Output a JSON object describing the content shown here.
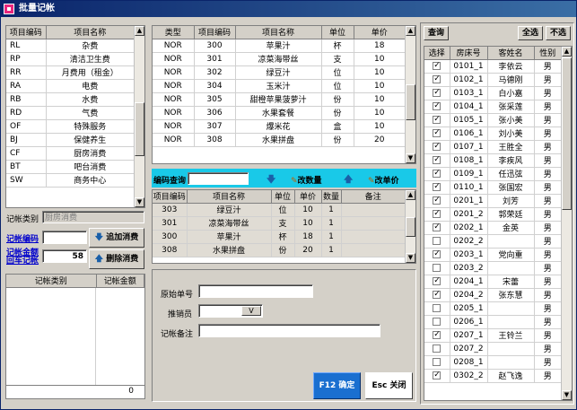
{
  "window": {
    "title": "批量记帐"
  },
  "items_table": {
    "headers": [
      "项目编码",
      "项目名称"
    ],
    "rows": [
      [
        "RL",
        "杂费"
      ],
      [
        "RP",
        "清洁卫生费"
      ],
      [
        "RR",
        "月费用（租金）"
      ],
      [
        "RA",
        "电费"
      ],
      [
        "RB",
        "水费"
      ],
      [
        "RD",
        "气费"
      ],
      [
        "OF",
        "特殊服务"
      ],
      [
        "BJ",
        "保健养生"
      ],
      [
        "CF",
        "厨房消费"
      ],
      [
        "BT",
        "吧台消费"
      ],
      [
        "SW",
        "商务中心"
      ]
    ]
  },
  "account_type": {
    "label": "记帐类别",
    "value": "厨房消费"
  },
  "account_code": {
    "label": "记帐编码",
    "value": ""
  },
  "account_amount": {
    "label": "记帐金额",
    "value": "58"
  },
  "post_label": "回车记帐",
  "add_button": "追加消费",
  "delete_button": "删除消费",
  "summary_table": {
    "headers": [
      "记帐类别",
      "记帐金额"
    ],
    "total": "0"
  },
  "product_table": {
    "headers": [
      "类型",
      "项目编码",
      "项目名称",
      "单位",
      "单价"
    ],
    "rows": [
      [
        "NOR",
        "300",
        "苹果汁",
        "杯",
        "18"
      ],
      [
        "NOR",
        "301",
        "凉菜海带丝",
        "支",
        "10"
      ],
      [
        "NOR",
        "302",
        "绿豆汁",
        "位",
        "10"
      ],
      [
        "NOR",
        "304",
        "玉米汁",
        "位",
        "10"
      ],
      [
        "NOR",
        "305",
        "甜橙苹果菠萝汁",
        "份",
        "10"
      ],
      [
        "NOR",
        "306",
        "水果套餐",
        "份",
        "10"
      ],
      [
        "NOR",
        "307",
        "爆米花",
        "盒",
        "10"
      ],
      [
        "NOR",
        "308",
        "水果拼盘",
        "份",
        "20"
      ]
    ]
  },
  "code_query": {
    "label": "编码查询",
    "value": ""
  },
  "change_qty": "改数量",
  "change_price": "改单价",
  "selected_table": {
    "headers": [
      "项目编码",
      "项目名称",
      "单位",
      "单价",
      "数量",
      "备注"
    ],
    "rows": [
      [
        "303",
        "绿豆汁",
        "位",
        "10",
        "1",
        ""
      ],
      [
        "301",
        "凉菜海带丝",
        "支",
        "10",
        "1",
        ""
      ],
      [
        "300",
        "苹果汁",
        "杯",
        "18",
        "1",
        ""
      ],
      [
        "308",
        "水果拼盘",
        "份",
        "20",
        "1",
        ""
      ]
    ]
  },
  "form": {
    "orig_no_label": "原始单号",
    "orig_no_value": "",
    "seller_label": "推销员",
    "seller_value": "",
    "note_label": "记帐备注",
    "note_value": ""
  },
  "confirm_button": "F12 确定",
  "close_button": "Esc 关闭",
  "query_button": "查询",
  "select_all_button": "全选",
  "select_none_button": "不选",
  "rooms_table": {
    "headers": [
      "选择",
      "房床号",
      "客姓名",
      "性别"
    ],
    "rows": [
      {
        "checked": true,
        "room": "0101_1",
        "name": "李依云",
        "sex": "男"
      },
      {
        "checked": true,
        "room": "0102_1",
        "name": "马德刚",
        "sex": "男"
      },
      {
        "checked": true,
        "room": "0103_1",
        "name": "白小嘉",
        "sex": "男"
      },
      {
        "checked": true,
        "room": "0104_1",
        "name": "张采莲",
        "sex": "男"
      },
      {
        "checked": true,
        "room": "0105_1",
        "name": "张小美",
        "sex": "男"
      },
      {
        "checked": true,
        "room": "0106_1",
        "name": "刘小美",
        "sex": "男"
      },
      {
        "checked": true,
        "room": "0107_1",
        "name": "王胜全",
        "sex": "男"
      },
      {
        "checked": true,
        "room": "0108_1",
        "name": "李疾风",
        "sex": "男"
      },
      {
        "checked": true,
        "room": "0109_1",
        "name": "任迅弦",
        "sex": "男"
      },
      {
        "checked": true,
        "room": "0110_1",
        "name": "张国宏",
        "sex": "男"
      },
      {
        "checked": true,
        "room": "0201_1",
        "name": "刘芳",
        "sex": "男"
      },
      {
        "checked": true,
        "room": "0201_2",
        "name": "郭荣廷",
        "sex": "男"
      },
      {
        "checked": true,
        "room": "0202_1",
        "name": "金英",
        "sex": "男"
      },
      {
        "checked": false,
        "room": "0202_2",
        "name": "",
        "sex": "男"
      },
      {
        "checked": true,
        "room": "0203_1",
        "name": "党向重",
        "sex": "男"
      },
      {
        "checked": false,
        "room": "0203_2",
        "name": "",
        "sex": "男"
      },
      {
        "checked": true,
        "room": "0204_1",
        "name": "宋蕾",
        "sex": "男"
      },
      {
        "checked": true,
        "room": "0204_2",
        "name": "张东慧",
        "sex": "男"
      },
      {
        "checked": false,
        "room": "0205_1",
        "name": "",
        "sex": "男"
      },
      {
        "checked": false,
        "room": "0206_1",
        "name": "",
        "sex": "男"
      },
      {
        "checked": true,
        "room": "0207_1",
        "name": "王铃兰",
        "sex": "男"
      },
      {
        "checked": false,
        "room": "0207_2",
        "name": "",
        "sex": "男"
      },
      {
        "checked": false,
        "room": "0208_1",
        "name": "",
        "sex": "男"
      },
      {
        "checked": true,
        "room": "0302_2",
        "name": "赵飞逸",
        "sex": "男"
      }
    ]
  }
}
